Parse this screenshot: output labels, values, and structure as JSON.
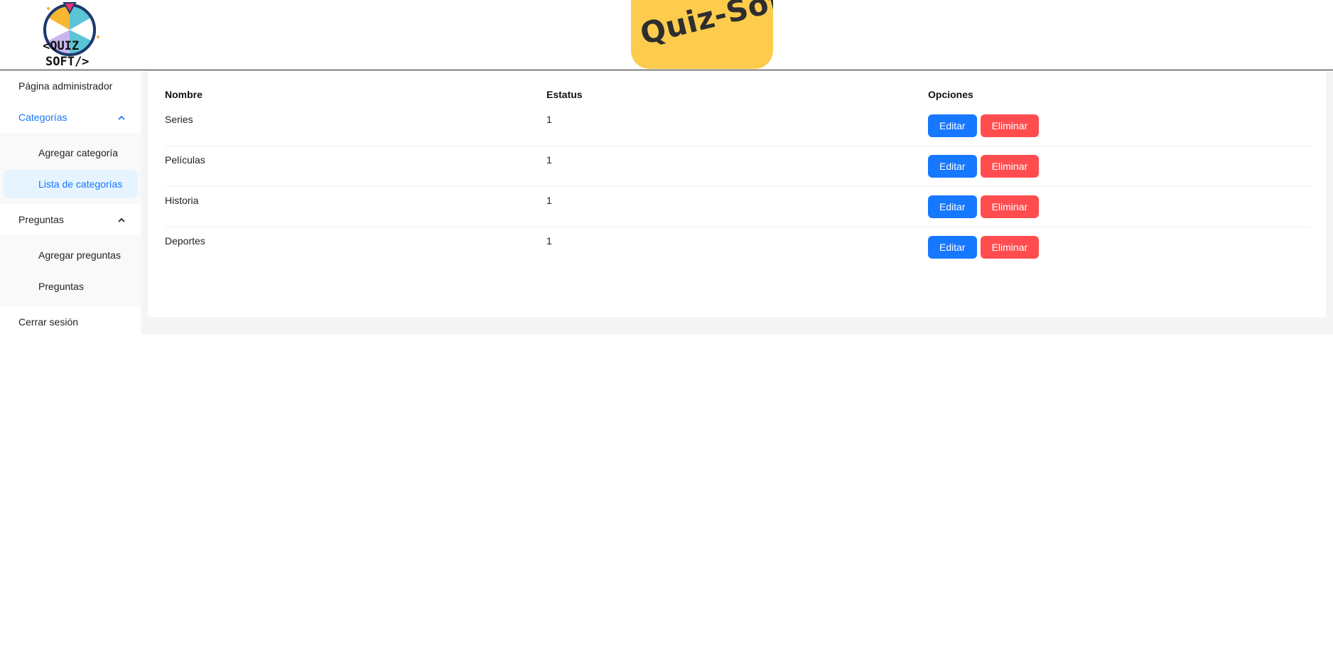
{
  "header": {
    "brand": "Quiz-Soft",
    "logo_text_top": "<QUIZ",
    "logo_text_bottom": "SOFT/>"
  },
  "colors": {
    "accent": "#1677ff",
    "danger": "#ff4d4f",
    "brand": "#fdcc4d"
  },
  "sidebar": {
    "admin_page": "Página administrador",
    "categories": {
      "label": "Categorías",
      "chevron": "chevron-up-icon",
      "items": [
        "Agregar categoría",
        "Lista de categorías"
      ]
    },
    "questions": {
      "label": "Preguntas",
      "chevron": "chevron-up-icon",
      "items": [
        "Agregar preguntas",
        "Preguntas"
      ]
    },
    "logout": "Cerrar sesión"
  },
  "table": {
    "headers": [
      "Nombre",
      "Estatus",
      "Opciones"
    ],
    "rows": [
      {
        "name": "Series",
        "status": "1"
      },
      {
        "name": "Películas",
        "status": "1"
      },
      {
        "name": "Historia",
        "status": "1"
      },
      {
        "name": "Deportes",
        "status": "1"
      }
    ],
    "edit_label": "Editar",
    "delete_label": "Eliminar"
  }
}
